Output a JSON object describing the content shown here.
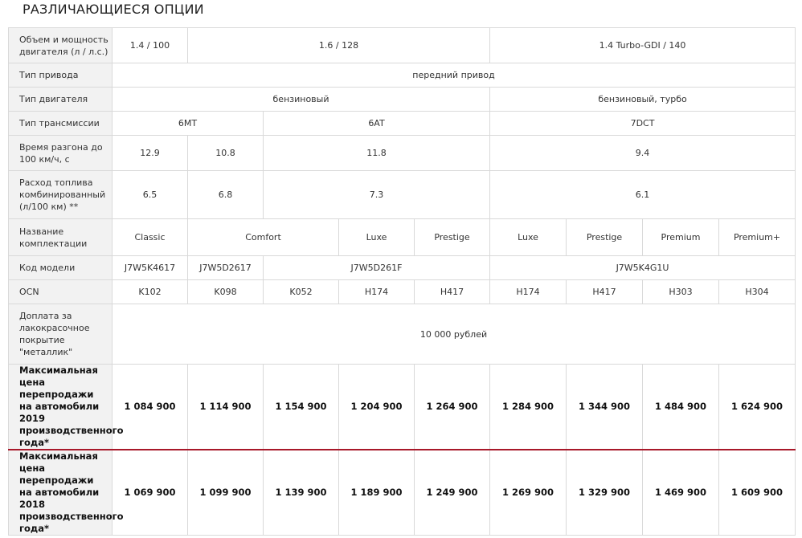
{
  "page": {
    "title": "РАЗЛИЧАЮЩИЕСЯ ОПЦИИ"
  },
  "table": {
    "rows": [
      {
        "label": "Объем и мощность двигателя (л / л.с.)",
        "cells": [
          "1.4 / 100",
          "1.6 / 128",
          "1.4 Turbo-GDI / 140"
        ]
      },
      {
        "label": "Тип привода",
        "cells": [
          "передний привод"
        ]
      },
      {
        "label": "Тип двигателя",
        "cells": [
          "бензиновый",
          "бензиновый, турбо"
        ]
      },
      {
        "label": "Тип трансмиссии",
        "cells": [
          "6MT",
          "6AT",
          "7DCT"
        ]
      },
      {
        "label": "Время разгона до 100 км/ч, с",
        "cells": [
          "12.9",
          "10.8",
          "11.8",
          "9.4"
        ]
      },
      {
        "label": "Расход топлива комбинированный (л/100 км) **",
        "cells": [
          "6.5",
          "6.8",
          "7.3",
          "6.1"
        ]
      },
      {
        "label": "Название комплектации",
        "cells": [
          "Classic",
          "Comfort",
          "Luxe",
          "Prestige",
          "Luxe",
          "Prestige",
          "Premium",
          "Premium+"
        ]
      },
      {
        "label": "Код модели",
        "cells": [
          "J7W5K4617",
          "J7W5D2617",
          "J7W5D261F",
          "J7W5K4G1U"
        ]
      },
      {
        "label": "OCN",
        "cells": [
          "K102",
          "K098",
          "K052",
          "H174",
          "H417",
          "H174",
          "H417",
          "H303",
          "H304"
        ]
      },
      {
        "label": "Доплата за лакокрасочное покрытие \"металлик\"",
        "cells": [
          "10 000 рублей"
        ]
      },
      {
        "label": "Максимальная цена перепродажи на автомобили 2019 производственного года*",
        "cells": [
          "1 084 900",
          "1 114 900",
          "1 154 900",
          "1 204 900",
          "1 264 900",
          "1 284 900",
          "1 344 900",
          "1 484 900",
          "1 624 900"
        ]
      },
      {
        "label": "Максимальная цена перепродажи на автомобили 2018 производственного года*",
        "cells": [
          "1 069 900",
          "1 099 900",
          "1 139 900",
          "1 189 900",
          "1 249 900",
          "1 269 900",
          "1 329 900",
          "1 469 900",
          "1 609 900"
        ]
      }
    ]
  },
  "colors": {
    "label_bg": "#f2f2f2",
    "border": "#d9d9d9",
    "divider": "#a8182a",
    "text": "#333333"
  }
}
